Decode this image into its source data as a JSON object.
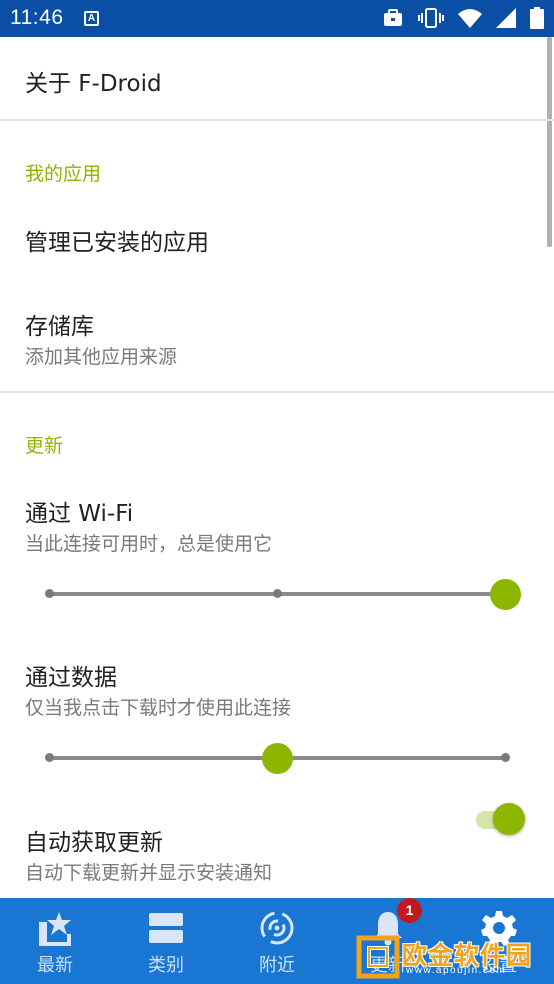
{
  "status_bar": {
    "time": "11:46",
    "icons": [
      "a-notification-icon",
      "briefcase-icon",
      "vibrate-icon",
      "wifi-icon",
      "signal-icon",
      "battery-icon"
    ]
  },
  "about": {
    "title": "关于 F-Droid"
  },
  "my_apps": {
    "header": "我的应用",
    "manage_installed": "管理已安装的应用",
    "repositories": {
      "title": "存储库",
      "subtitle": "添加其他应用来源"
    }
  },
  "updates": {
    "header": "更新",
    "wifi": {
      "title": "通过 Wi-Fi",
      "subtitle": "当此连接可用时，总是使用它",
      "slider_value": 2,
      "slider_max": 2
    },
    "data": {
      "title": "通过数据",
      "subtitle": "仅当我点击下载时才使用此连接",
      "slider_value": 1,
      "slider_max": 2
    },
    "auto_fetch": {
      "title": "自动获取更新",
      "subtitle": "自动下载更新并显示安装通知",
      "enabled": true
    }
  },
  "bottom_nav": {
    "items": [
      {
        "label": "最新",
        "icon": "star-bookmark-icon"
      },
      {
        "label": "类别",
        "icon": "categories-icon"
      },
      {
        "label": "附近",
        "icon": "nearby-icon"
      },
      {
        "label": "更新",
        "icon": "bell-icon"
      },
      {
        "label": "设置",
        "icon": "gear-icon"
      }
    ],
    "badge_count": "1"
  },
  "watermark": {
    "text": "欧金软件园",
    "url": "www.apoujin.com"
  },
  "colors": {
    "status_bar": "#0a4ea6",
    "accent": "#8db600",
    "bottom_nav": "#1976d2",
    "badge": "#c2181f"
  }
}
